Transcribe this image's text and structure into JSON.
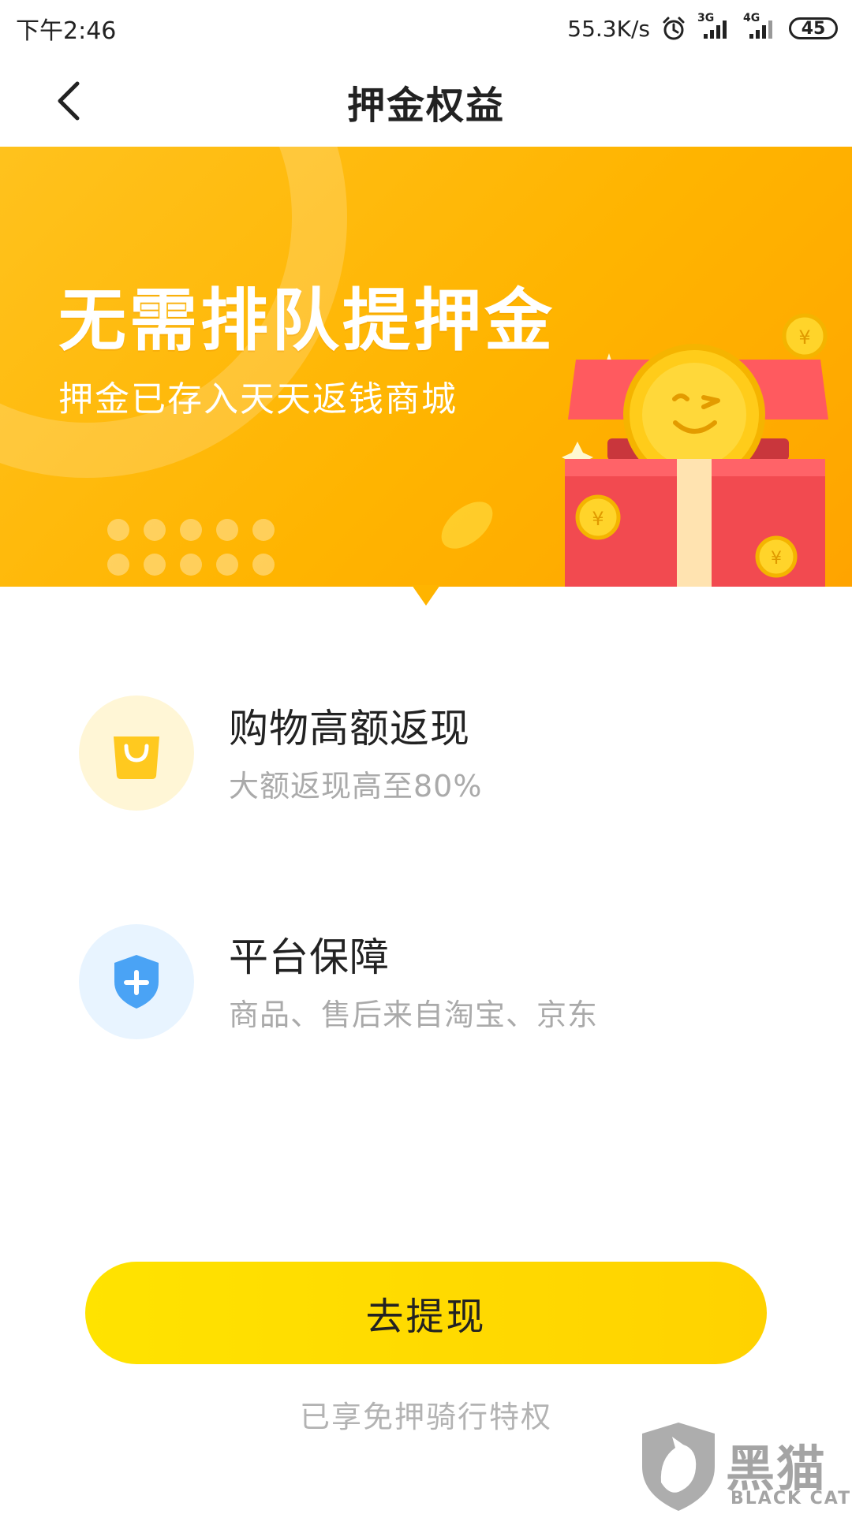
{
  "status_bar": {
    "time": "下午2:46",
    "speed": "55.3K/s",
    "net1": "3G",
    "net2": "4G",
    "battery": "45"
  },
  "header": {
    "title": "押金权益"
  },
  "banner": {
    "title": "无需排队提押金",
    "subtitle": "押金已存入天天返钱商城"
  },
  "features": [
    {
      "title": "购物高额返现",
      "desc": "大额返现高至80%",
      "icon": "shopping-bag-icon"
    },
    {
      "title": "平台保障",
      "desc": "商品、售后来自淘宝、京东",
      "icon": "shield-plus-icon"
    }
  ],
  "cta": {
    "label": "去提现"
  },
  "footnote": "已享免押骑行特权",
  "watermark": {
    "cn": "黑猫",
    "en": "BLACK CAT"
  },
  "colors": {
    "banner": "#ffb400",
    "cta": "#ffd200",
    "shield": "#4aa3f5"
  }
}
